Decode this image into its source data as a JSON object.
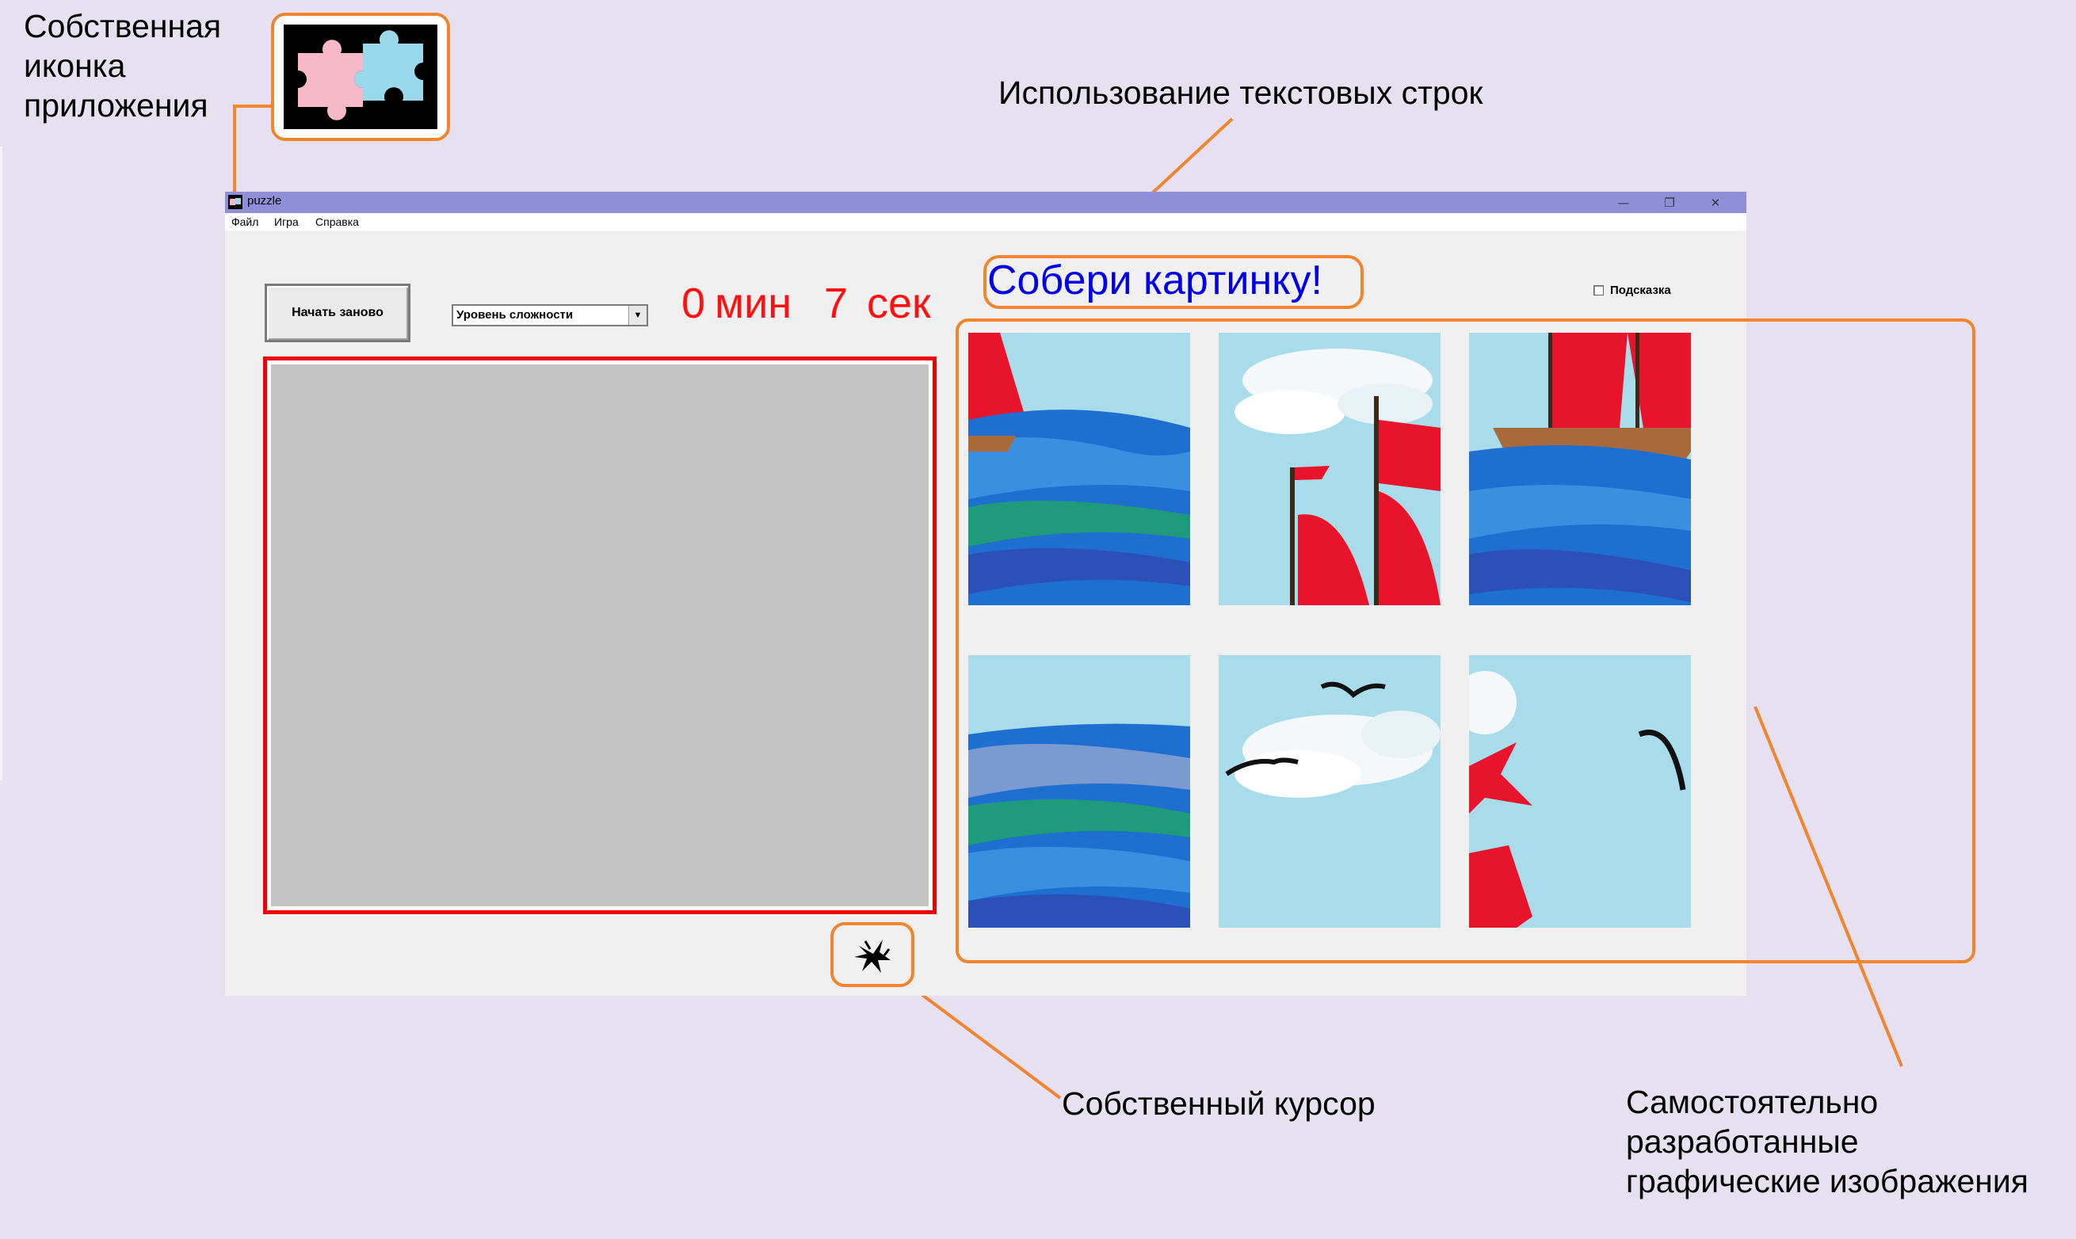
{
  "annotations": {
    "app_icon": [
      "Собственная",
      "иконка",
      "приложения"
    ],
    "text_strings": "Использование текстовых строк",
    "cursor": "Собственный курсор",
    "graphics": [
      "Самостоятельно",
      "разработанные",
      "графические изображения"
    ]
  },
  "window": {
    "title": "puzzle",
    "minimize_icon": "minimize-icon",
    "restore_icon": "restore-icon",
    "close_icon": "close-icon"
  },
  "menu": {
    "file": "Файл",
    "game": "Игра",
    "help": "Справка"
  },
  "controls": {
    "restart_label": "Начать заново",
    "difficulty_value": "Уровень сложности",
    "hint_label": "Подсказка",
    "hint_checked": false
  },
  "timer": {
    "minutes": "0",
    "min_unit": "мин",
    "seconds": "7",
    "sec_unit": "сек"
  },
  "heading": "Собери картинку!",
  "tiles": [
    "ship-sail-left-tile",
    "clouds-flag-tile",
    "ship-deck-tile",
    "waves-tile",
    "clouds-gulls-tile",
    "sail-gull-tile"
  ],
  "colors": {
    "accent_orange": "#f0852d",
    "title_bar": "#8f8fd8",
    "timer_red": "#ff1010",
    "heading_blue": "#0000e8",
    "field_border": "#f00000"
  }
}
